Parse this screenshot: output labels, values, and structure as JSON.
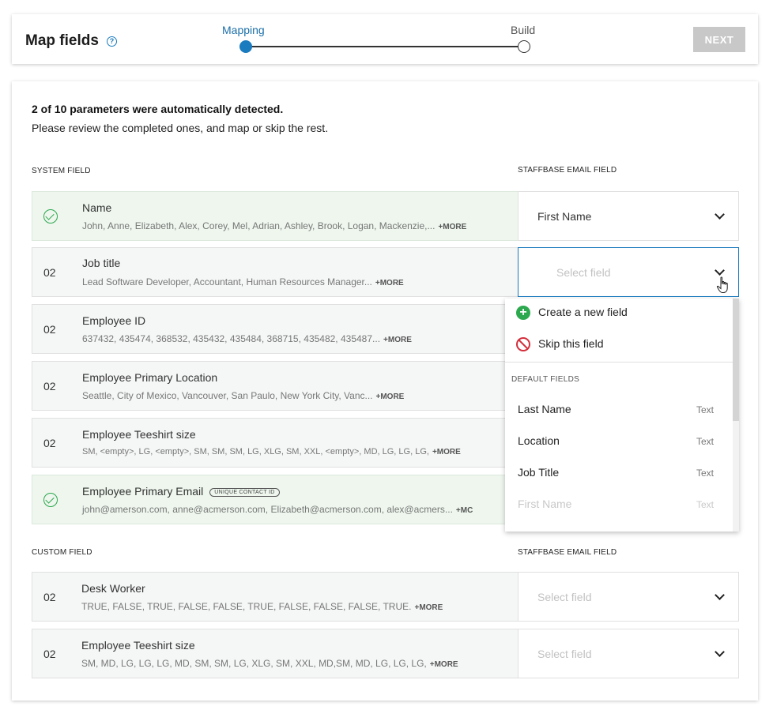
{
  "header": {
    "title": "Map fields",
    "help_icon": "?",
    "steps": [
      {
        "label": "Mapping",
        "state": "active"
      },
      {
        "label": "Build",
        "state": "pending"
      }
    ],
    "next_label": "NEXT"
  },
  "summary": {
    "bold": "2 of 10 parameters were automatically detected.",
    "text": "Please review the completed ones, and map or skip the rest."
  },
  "system_section": {
    "left_label": "SYSTEM FIELD",
    "right_label": "STAFFBASE EMAIL FIELD",
    "rows": [
      {
        "status": "detected",
        "number": "",
        "title": "Name",
        "badge": "",
        "sample": "John, Anne, Elizabeth, Alex, Corey, Mel, Adrian, Ashley, Brook, Logan, Mackenzie,...",
        "more": "+MORE",
        "field_value": "First Name",
        "field_placeholder": ""
      },
      {
        "status": "pending",
        "number": "02",
        "title": "Job title",
        "badge": "",
        "sample": "Lead Software Developer, Accountant, Human Resources Manager...",
        "more": "+MORE",
        "field_value": "",
        "field_placeholder": "Select field"
      },
      {
        "status": "pending",
        "number": "02",
        "title": "Employee ID",
        "badge": "",
        "sample": "637432, 435474, 368532, 435432, 435484, 368715, 435482, 435487...",
        "more": "+MORE",
        "field_value": "",
        "field_placeholder": ""
      },
      {
        "status": "pending",
        "number": "02",
        "title": "Employee Primary Location",
        "badge": "",
        "sample": "Seattle, City of Mexico, Vancouver, San Paulo, New York City, Vanc...",
        "more": "+MORE",
        "field_value": "",
        "field_placeholder": ""
      },
      {
        "status": "pending",
        "number": "02",
        "title": "Employee Teeshirt size",
        "badge": "",
        "sample": "SM, <empty>, LG, <empty>, SM, SM, SM, LG, XLG, SM, XXL, <empty>, MD, LG, LG, LG,",
        "more": "+MORE",
        "field_value": "",
        "field_placeholder": ""
      },
      {
        "status": "detected",
        "number": "",
        "title": "Employee Primary Email",
        "badge": "UNIQUE CONTACT ID",
        "sample": "john@amerson.com, anne@acmerson.com, Elizabeth@acmerson.com, alex@acmers...",
        "more": "+MC",
        "field_value": "",
        "field_placeholder": ""
      }
    ]
  },
  "custom_section": {
    "left_label": "CUSTOM FIELD",
    "right_label": "STAFFBASE EMAIL FIELD",
    "rows": [
      {
        "status": "pending",
        "number": "02",
        "title": "Desk Worker",
        "badge": "",
        "sample": "TRUE, FALSE, TRUE, FALSE, FALSE, TRUE, FALSE, FALSE, FALSE, TRUE.",
        "more": "+MORE",
        "field_value": "",
        "field_placeholder": "Select field"
      },
      {
        "status": "pending",
        "number": "02",
        "title": "Employee Teeshirt size",
        "badge": "",
        "sample": "SM, MD, LG, LG, LG, MD, SM, SM, LG, XLG, SM, XXL, MD,SM, MD, LG, LG, LG,",
        "more": "+MORE",
        "field_value": "",
        "field_placeholder": "Select field"
      }
    ]
  },
  "dropdown": {
    "create_label": "Create a new field",
    "skip_label": "Skip this field",
    "section_label": "DEFAULT FIELDS",
    "items": [
      {
        "label": "Last Name",
        "type": "Text",
        "disabled": false
      },
      {
        "label": "Location",
        "type": "Text",
        "disabled": false
      },
      {
        "label": "Job Title",
        "type": "Text",
        "disabled": false
      },
      {
        "label": "First Name",
        "type": "Text",
        "disabled": true
      }
    ]
  },
  "colors": {
    "accent": "#1a7bbf",
    "success": "#2ca84e",
    "danger": "#d32f3c",
    "detected_row": "#eef6ee",
    "disabled_button": "#c8c8c8"
  },
  "icons": {
    "help": "help-circle-icon",
    "check": "check-circle-icon",
    "chevron": "chevron-down-icon",
    "create": "plus-circle-icon",
    "skip": "block-icon",
    "cursor": "hand-pointer-icon"
  }
}
